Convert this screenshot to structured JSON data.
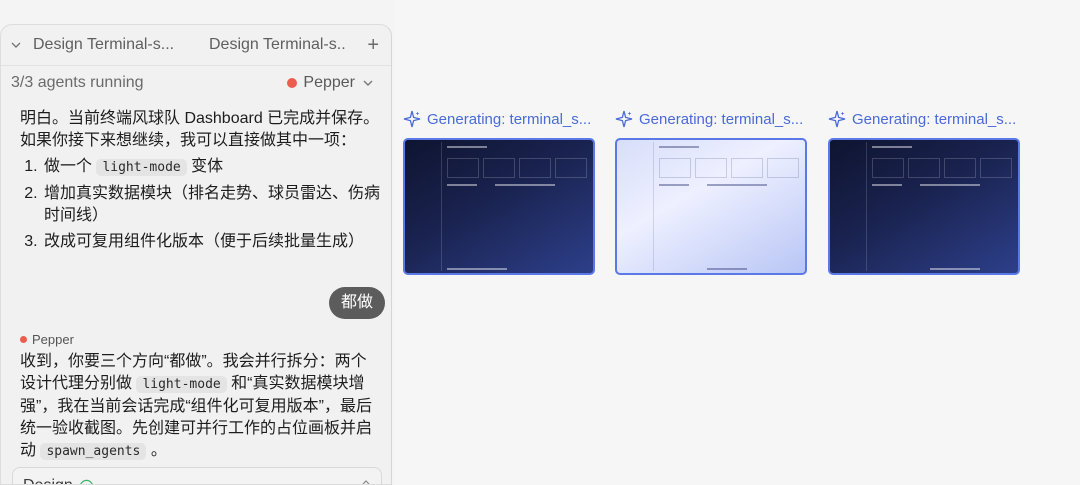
{
  "tabs": [
    {
      "label": "Design Terminal-s..."
    },
    {
      "label": "Design Terminal-s.."
    }
  ],
  "status": {
    "agents_running": "3/3 agents running",
    "agent_name": "Pepper"
  },
  "chat": {
    "message1_line1": "明白。当前终端风球队 Dashboard 已完成并保存。",
    "message1_line2": "如果你接下来想继续，我可以直接做其中一项：",
    "options": [
      {
        "pre": "做一个 ",
        "code": "light-mode",
        "post": " 变体"
      },
      {
        "text": "增加真实数据模块（排名走势、球员雷达、伤病时间线）"
      },
      {
        "text": "改成可复用组件化版本（便于后续批量生成）"
      }
    ],
    "user_reply": "都做",
    "sender": "Pepper",
    "reply_part1": "收到，你要三个方向“都做”。我会并行拆分：两个设计代理分别做 ",
    "reply_code1": "light-mode",
    "reply_part2": " 和“真实数据模块增强”，我在当前会话完成“组件化可复用版本”，最后统一验收截图。先创建可并行工作的占位画板并启动 ",
    "reply_code2": "spawn_agents",
    "reply_part3": " 。"
  },
  "mode": {
    "label": "Design"
  },
  "canvas": {
    "cards": [
      {
        "title": "Generating: terminal_s...",
        "theme": "dark"
      },
      {
        "title": "Generating: terminal_s...",
        "theme": "light"
      },
      {
        "title": "Generating: terminal_s...",
        "theme": "dark"
      }
    ]
  },
  "colors": {
    "accent": "#4a6ad8",
    "agent_dot": "#ec5d4f"
  }
}
